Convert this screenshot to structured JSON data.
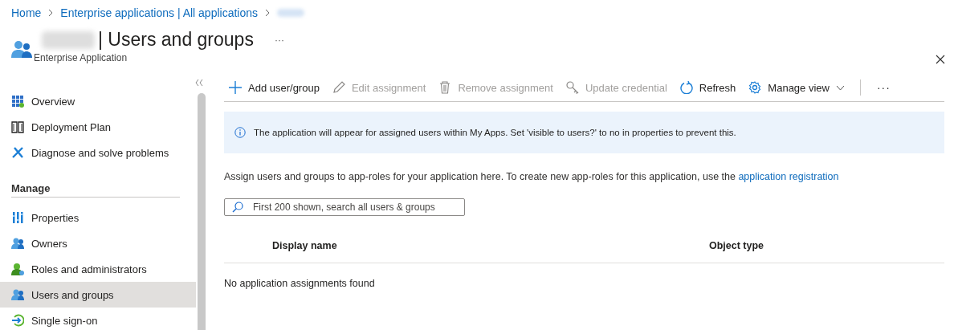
{
  "breadcrumb": [
    "Home",
    "Enterprise applications | All applications"
  ],
  "header": {
    "title": "| Users and groups",
    "subtitle": "Enterprise Application",
    "more": "···"
  },
  "sidebar": {
    "sections": [
      {
        "items": [
          {
            "label": "Overview",
            "selected": false
          },
          {
            "label": "Deployment Plan",
            "selected": false
          },
          {
            "label": "Diagnose and solve problems",
            "selected": false
          }
        ]
      },
      {
        "heading": "Manage",
        "items": [
          {
            "label": "Properties",
            "selected": false
          },
          {
            "label": "Owners",
            "selected": false
          },
          {
            "label": "Roles and administrators",
            "selected": false
          },
          {
            "label": "Users and groups",
            "selected": true
          },
          {
            "label": "Single sign-on",
            "selected": false
          }
        ]
      }
    ]
  },
  "toolbar": {
    "items": [
      {
        "label": "Add user/group",
        "disabled": false
      },
      {
        "label": "Edit assignment",
        "disabled": true
      },
      {
        "label": "Remove assignment",
        "disabled": true
      },
      {
        "label": "Update credential",
        "disabled": true
      },
      {
        "label": "Refresh",
        "disabled": false
      },
      {
        "label": "Manage view",
        "disabled": false
      }
    ],
    "more": "···"
  },
  "info_banner": "The application will appear for assigned users within My Apps. Set 'visible to users?' to no in properties to prevent this.",
  "description": {
    "text": "Assign users and groups to app-roles for your application here. To create new app-roles for this application, use the",
    "link": "application registration"
  },
  "search": {
    "placeholder": "First 200 shown, search all users & groups"
  },
  "table": {
    "columns": [
      "Display name",
      "Object type"
    ],
    "empty_message": "No application assignments found"
  }
}
